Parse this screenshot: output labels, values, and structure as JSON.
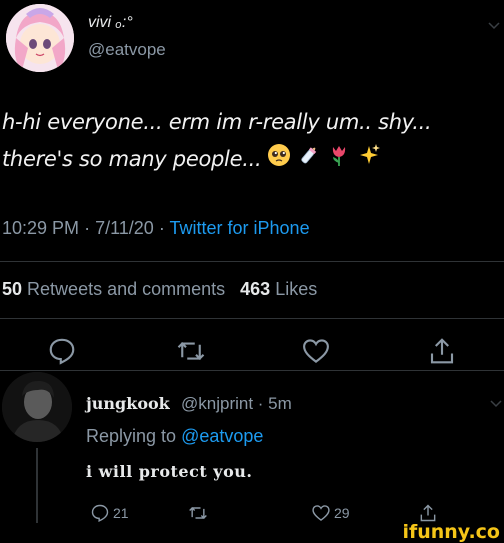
{
  "tweet": {
    "display_name": "vivi ₒ:°",
    "handle": "@eatvope",
    "text_line1": "h-hi everyone... erm im r-really um.. shy...",
    "text_line2": "there's so many people...",
    "emojis": [
      "pleading-face",
      "baby-bottle",
      "tulip",
      "sparkles"
    ],
    "time": "10:29 PM",
    "date": "7/11/20",
    "separator": "·",
    "source": "Twitter for iPhone",
    "retweets_count": "50",
    "retweets_label": "Retweets and comments",
    "likes_count": "463",
    "likes_label": "Likes"
  },
  "actions": [
    "reply-icon",
    "retweet-icon",
    "like-icon",
    "share-icon"
  ],
  "reply": {
    "display_name": "jungkook",
    "handle_time": "@knjprint · 5m",
    "replying_prefix": "Replying to",
    "replying_to": "@eatvope",
    "text": "i will protect you.",
    "reply_count": "21",
    "like_count": "29"
  },
  "watermark": "ifunny.co",
  "colors": {
    "background": "#000000",
    "accent": "#1d9bf0",
    "muted": "#8b98a5",
    "watermark": "#f5c518"
  }
}
